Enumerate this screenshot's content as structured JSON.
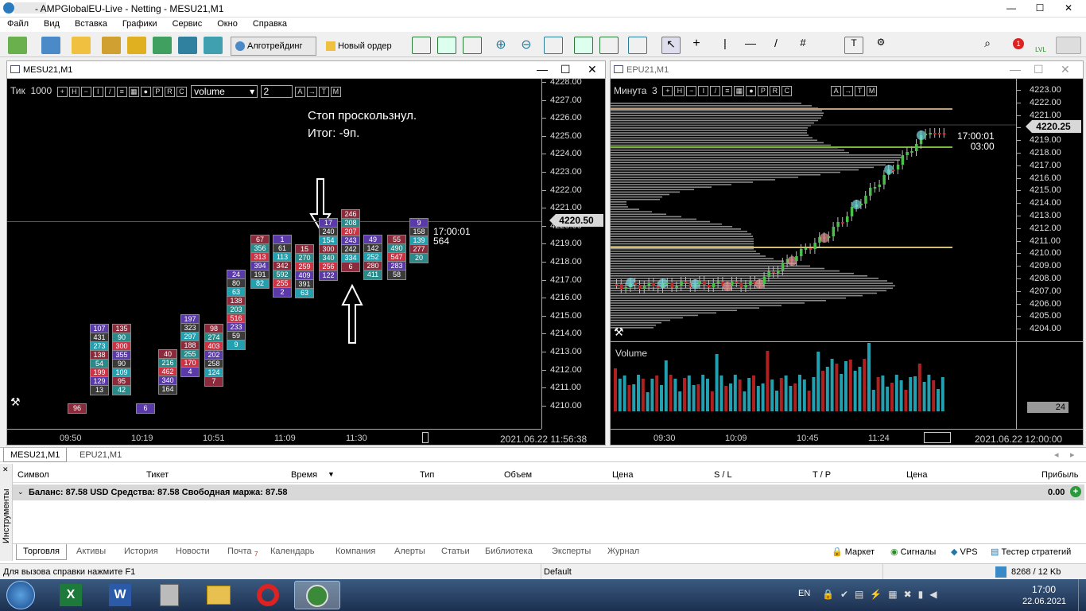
{
  "window": {
    "title": "- AMPGlobalEU-Live - Netting - MESU21,M1",
    "minimize": "—",
    "maximize": "☐",
    "close": "✕"
  },
  "menu": [
    "Файл",
    "Вид",
    "Вставка",
    "Графики",
    "Сервис",
    "Окно",
    "Справка"
  ],
  "toolbar": {
    "algo": "Алготрейдинг",
    "new_order": "Новый ордер",
    "alerts_badge": "1",
    "lvl": "LVL"
  },
  "left_chart": {
    "title": "MESU21,M1",
    "mode": "Тик",
    "ticks": "1000",
    "dropdown": "volume",
    "spin": "2",
    "annotation": [
      "Стоп проскользнул.",
      "Итог: -9п."
    ],
    "price_labels": [
      "4228.00",
      "4227.00",
      "4226.00",
      "4225.00",
      "4224.00",
      "4223.00",
      "4222.00",
      "4221.00",
      "4220.00",
      "4219.00",
      "4218.00",
      "4217.00",
      "4216.00",
      "4215.00",
      "4214.00",
      "4213.00",
      "4212.00",
      "4211.00",
      "4210.00"
    ],
    "current_price": "4220.50",
    "timer": "17:00:01",
    "timer_sub": "564",
    "time_labels": [
      "09:50",
      "10:19",
      "10:51",
      "11:09",
      "11:30"
    ],
    "date": "2021.06.22 11:56:38",
    "columns": [
      {
        "cells": [
          "96"
        ]
      },
      {
        "cells": [
          "107",
          "431",
          "273",
          "138",
          "54",
          "199",
          "129",
          "13"
        ]
      },
      {
        "cells": [
          "135",
          "90",
          "300",
          "355",
          "90",
          "109",
          "95",
          "42"
        ]
      },
      {
        "cells": [
          "6"
        ]
      },
      {
        "cells": [
          "40",
          "216",
          "462",
          "340",
          "164"
        ]
      },
      {
        "cells": [
          "197",
          "323",
          "297",
          "188",
          "255",
          "170",
          "4"
        ]
      },
      {
        "cells": [
          "98",
          "274",
          "403",
          "202",
          "258",
          "124",
          "7"
        ]
      },
      {
        "cells": [
          "24",
          "80",
          "63",
          "138",
          "203",
          "516",
          "233",
          "59",
          "9"
        ]
      },
      {
        "cells": [
          "67",
          "356",
          "313",
          "394",
          "191",
          "82"
        ]
      },
      {
        "cells": [
          "1",
          "61",
          "113",
          "342",
          "592",
          "255",
          "2"
        ]
      },
      {
        "cells": [
          "15",
          "270",
          "259",
          "409",
          "391",
          "63"
        ]
      },
      {
        "cells": [
          "17",
          "240",
          "154",
          "300",
          "340",
          "256",
          "122"
        ]
      },
      {
        "cells": [
          "246",
          "208",
          "207",
          "243",
          "242",
          "334",
          "6"
        ]
      },
      {
        "cells": [
          "49",
          "142",
          "252",
          "280",
          "411"
        ]
      },
      {
        "cells": [
          "55",
          "490",
          "547",
          "283",
          "58"
        ]
      },
      {
        "cells": [
          "9",
          "158",
          "139",
          "277",
          "20"
        ]
      }
    ]
  },
  "right_chart": {
    "title": "EPU21,M1",
    "mode": "Минута",
    "period": "3",
    "price_labels": [
      "4223.00",
      "4222.00",
      "4221.00",
      "4220.00",
      "4219.00",
      "4218.00",
      "4217.00",
      "4216.00",
      "4215.00",
      "4214.00",
      "4213.00",
      "4212.00",
      "4211.00",
      "4210.00",
      "4209.00",
      "4208.00",
      "4207.00",
      "4206.00",
      "4205.00",
      "4204.00"
    ],
    "current_price": "4220.25",
    "timer": "17:00:01",
    "timer_sub": "03:00",
    "volume_label": "Volume",
    "volume_value": "24",
    "time_labels": [
      "09:30",
      "10:09",
      "10:45",
      "11:24"
    ],
    "date": "2021.06.22 12:00:00"
  },
  "tabs": {
    "chart_tabs": [
      "MESU21,M1",
      "EPU21,M1"
    ]
  },
  "terminal": {
    "headers": [
      "Символ",
      "Тикет",
      "Время",
      "Тип",
      "Объем",
      "Цена",
      "S / L",
      "T / P",
      "Цена",
      "Прибыль"
    ],
    "balance": "Баланс: 87.58 USD  Средства: 87.58  Свободная маржа: 87.58",
    "profit": "0.00",
    "side_label": "Инструменты",
    "tabs": [
      "Торговля",
      "Активы",
      "История",
      "Новости",
      "Почта",
      "Календарь",
      "Компания",
      "Алерты",
      "Статьи",
      "Библиотека",
      "Эксперты",
      "Журнал"
    ],
    "mail_badge": "7",
    "right_tabs": [
      "Маркет",
      "Сигналы",
      "VPS",
      "Тестер стратегий"
    ]
  },
  "status": {
    "help": "Для вызова справки нажмите F1",
    "profile": "Default",
    "traffic": "8268 / 12 Kb"
  },
  "taskbar": {
    "lang": "EN",
    "time": "17:00",
    "date": "22.06.2021"
  }
}
